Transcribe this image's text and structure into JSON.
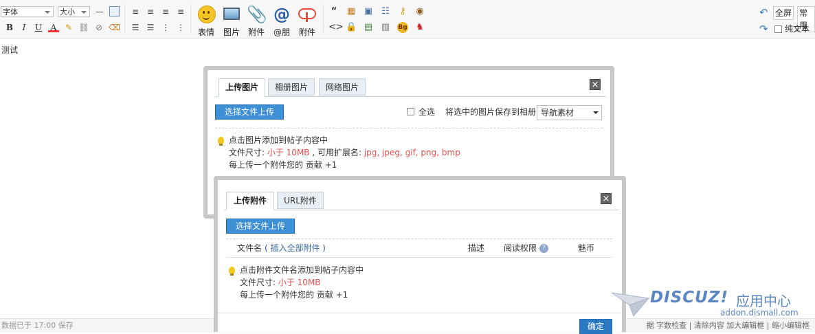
{
  "toolbar": {
    "font_select": "字体",
    "size_select": "大小",
    "buttons": {
      "emotion": "表情",
      "image": "图片",
      "attach": "附件",
      "at": "@朋",
      "cloud_attach": "附件"
    },
    "fullscreen": "全屏",
    "common": "常用",
    "plain_text": "纯文本",
    "plain_text_checked": false
  },
  "editor": {
    "content": "测试"
  },
  "statusbar": {
    "left": "数据已于 17:00 保存",
    "right": "据   字数检查 | 清除内容   加大编辑框 | 缩小编辑框"
  },
  "image_dialog": {
    "tabs": [
      "上传图片",
      "相册图片",
      "网络图片"
    ],
    "active_tab": 0,
    "close_label": "×",
    "upload_button": "选择文件上传",
    "select_all": "全选",
    "save_to_album": "将选中的图片保存到相册:",
    "album_value": "导航素材",
    "tip_line1": "点击图片添加到帖子内容中",
    "tip_line2_prefix": "文件尺寸: ",
    "tip_size": "小于 10MB",
    "tip_ext_prefix": " , 可用扩展名: ",
    "tip_exts": "jpg, jpeg, gif, png, bmp",
    "tip_line3": "每上传一个附件您的 贡献 +1"
  },
  "attach_dialog": {
    "tabs": [
      "上传附件",
      "URL附件"
    ],
    "active_tab": 0,
    "close_label": "×",
    "upload_button": "选择文件上传",
    "col_filename": "文件名",
    "col_insert_all": "( 插入全部附件 )",
    "col_desc": "描述",
    "col_perm": "阅读权限",
    "col_coin": "魅币",
    "tip_line1": "点击附件文件名添加到帖子内容中",
    "tip_line2_prefix": "文件尺寸: ",
    "tip_size": "小于 10MB",
    "tip_line3": "每上传一个附件您的 贡献 +1",
    "confirm": "确定"
  },
  "watermark": {
    "brand": "DISCUZ!",
    "cn": "应用中心",
    "url": "addon.dismall.com"
  },
  "colors": {
    "accent_blue": "#3d8fd6",
    "highlight_red": "#e2504f",
    "frame_gray": "#c8c8c8"
  }
}
